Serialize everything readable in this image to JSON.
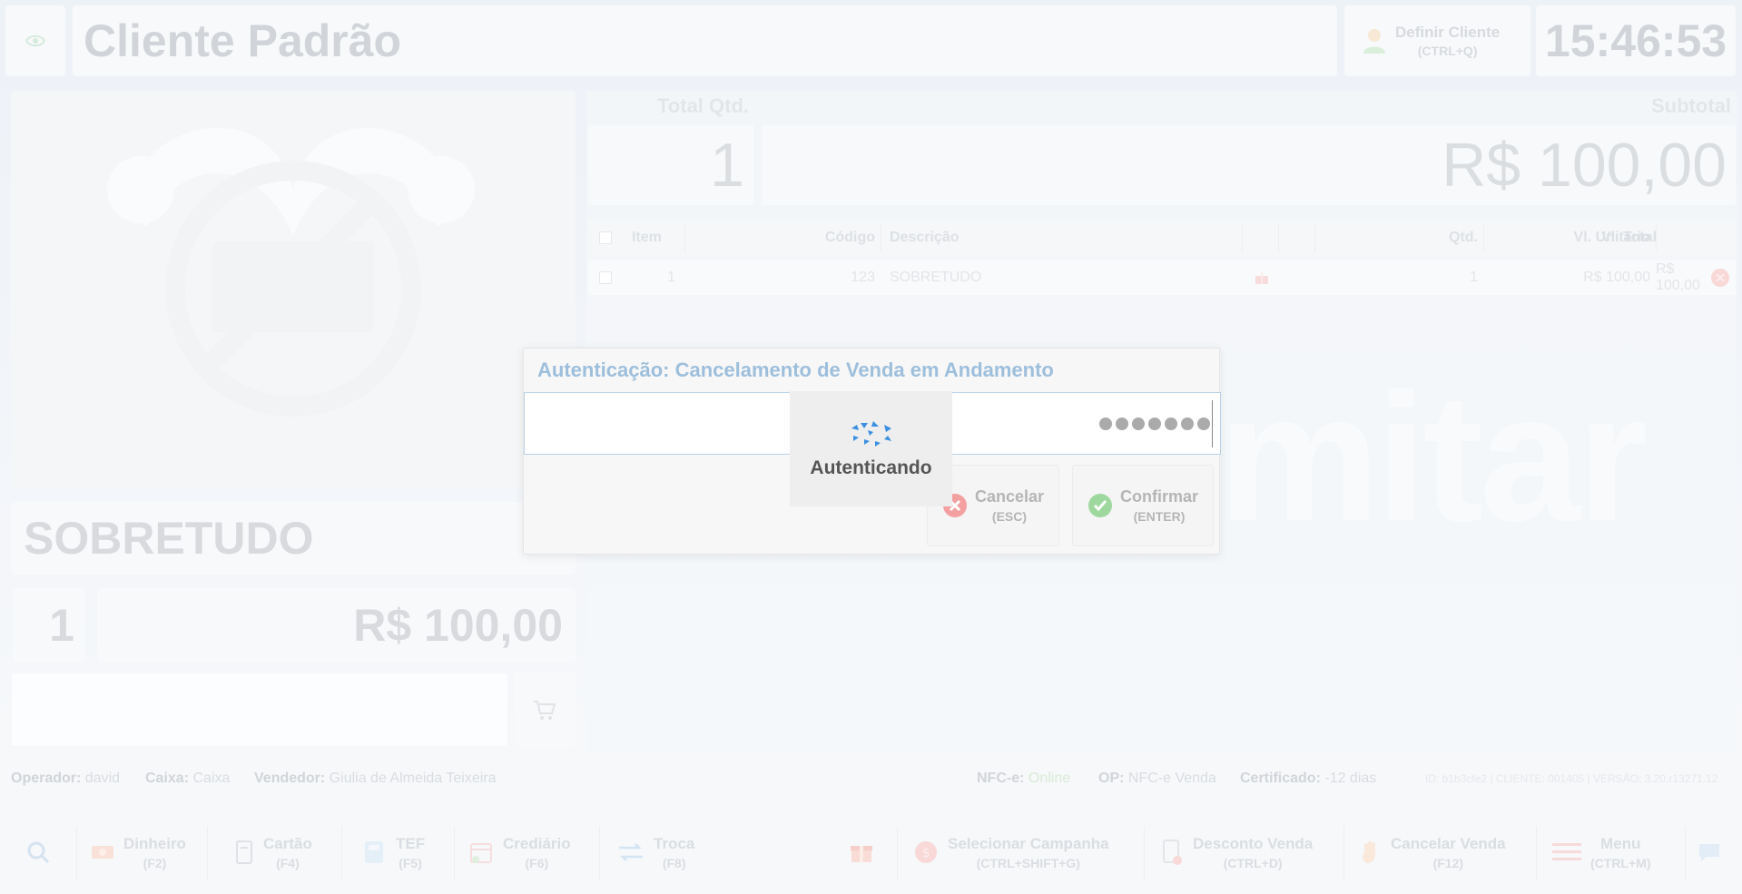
{
  "header": {
    "client_name": "Cliente Padrão",
    "define_client": {
      "label": "Definir Cliente",
      "shortcut": "(CTRL+Q)"
    },
    "clock": "15:46:53"
  },
  "product": {
    "name": "SOBRETUDO",
    "quantity": "1",
    "price": "R$ 100,00"
  },
  "totals": {
    "qty_label": "Total Qtd.",
    "qty_value": "1",
    "subtotal_label": "Subtotal",
    "subtotal_value": "R$ 100,00"
  },
  "table": {
    "headers": {
      "item": "Item",
      "code": "Código",
      "description": "Descrição",
      "qty": "Qtd.",
      "unit": "Vl. Unitário",
      "total": "Vl. Total"
    },
    "rows": [
      {
        "item": "1",
        "code": "123",
        "description": "SOBRETUDO",
        "qty": "1",
        "unit": "R$ 100,00",
        "total": "R$ 100,00"
      }
    ]
  },
  "watermark": "mitar",
  "status": {
    "operator_label": "Operador:",
    "operator": "david",
    "cashier_label": "Caixa:",
    "cashier": "Caixa",
    "seller_label": "Vendedor:",
    "seller": "Giulia de Almeida Teixeira",
    "nfce_label": "NFC-e:",
    "nfce": "Online",
    "op_label": "OP:",
    "op": "NFC-e Venda",
    "cert_label": "Certificado:",
    "cert": "-12 dias",
    "version": "ID: b1b3cfe2 | CLIENTE: 001405 | VERSÃO: 3.20.r13271.12"
  },
  "toolbar": {
    "cash": {
      "label": "Dinheiro",
      "key": "(F2)"
    },
    "card": {
      "label": "Cartão",
      "key": "(F4)"
    },
    "tef": {
      "label": "TEF",
      "key": "(F5)"
    },
    "credit": {
      "label": "Crediário",
      "key": "(F6)"
    },
    "exchange": {
      "label": "Troca",
      "key": "(F8)"
    },
    "campaign": {
      "label": "Selecionar Campanha",
      "key": "(CTRL+SHIFT+G)"
    },
    "discount": {
      "label": "Desconto Venda",
      "key": "(CTRL+D)"
    },
    "cancel_sale": {
      "label": "Cancelar Venda",
      "key": "(F12)"
    },
    "menu": {
      "label": "Menu",
      "key": "(CTRL+M)"
    }
  },
  "modal": {
    "title": "Autenticação: Cancelamento de Venda em Andamento",
    "loading": "Autenticando",
    "cancel": {
      "label": "Cancelar",
      "key": "(ESC)"
    },
    "confirm": {
      "label": "Confirmar",
      "key": "(ENTER)"
    }
  },
  "colors": {
    "accent_title": "#9dbfdc",
    "online": "#c6e0c0",
    "loader": "#3b8fe0",
    "cancel_red": "#f28b8b",
    "confirm_green": "#8fd18f"
  }
}
